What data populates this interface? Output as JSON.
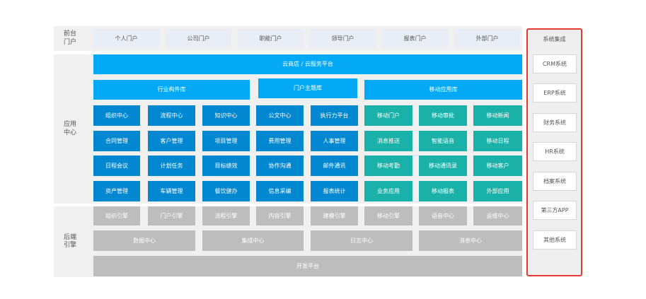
{
  "portal": {
    "label": "前台\n门户",
    "items": [
      "个人门户",
      "公司门户",
      "职能门户",
      "领导门户",
      "报表门户",
      "外部门户"
    ]
  },
  "app_center": {
    "label": "应用\n中心",
    "top_bar": "云商店 / 云服务平台",
    "libraries": [
      "行业构件库",
      "门户主题库",
      "移动应用库"
    ],
    "blue_rows": [
      [
        "组织中心",
        "流程中心",
        "知识中心",
        "公文中心",
        "执行力平台"
      ],
      [
        "合同管理",
        "客户管理",
        "项目管理",
        "费用管理",
        "人事管理"
      ],
      [
        "日程会议",
        "计划任务",
        "目标绩效",
        "协作沟通",
        "邮件通讯"
      ],
      [
        "资产管理",
        "车辆管理",
        "餐饮健办",
        "信息采编",
        "报表统计"
      ]
    ],
    "teal_rows": [
      [
        "移动门户",
        "移动审批",
        "移动新闻"
      ],
      [
        "消息推送",
        "智能语音",
        "移动日程"
      ],
      [
        "移动考勤",
        "移动通讯录",
        "移动客户"
      ],
      [
        "业务应用",
        "移动报表",
        "外部应用"
      ]
    ]
  },
  "backend": {
    "label": "后端\n引擎",
    "engines": [
      "组织引擎",
      "门户引擎",
      "流程引擎",
      "内容引擎",
      "建模引擎",
      "移动引擎",
      "语音中心",
      "运维中心"
    ],
    "centers": [
      "数据中心",
      "集成中心",
      "日志中心",
      "消息中心"
    ],
    "platform": "开发平台"
  },
  "system_integration": {
    "title": "系统集成",
    "items": [
      "CRM系统",
      "ERP系统",
      "财务系统",
      "HR系统",
      "档案系统",
      "第三方APP",
      "其他系统"
    ]
  },
  "colors": {
    "bar_blue": "#03a9f4",
    "module_blue": "#0288d1",
    "module_teal": "#1ab2a8",
    "engine_grey": "#bdbdbd",
    "portal_bg": "#e8edf6",
    "highlight_red": "#e53935"
  }
}
